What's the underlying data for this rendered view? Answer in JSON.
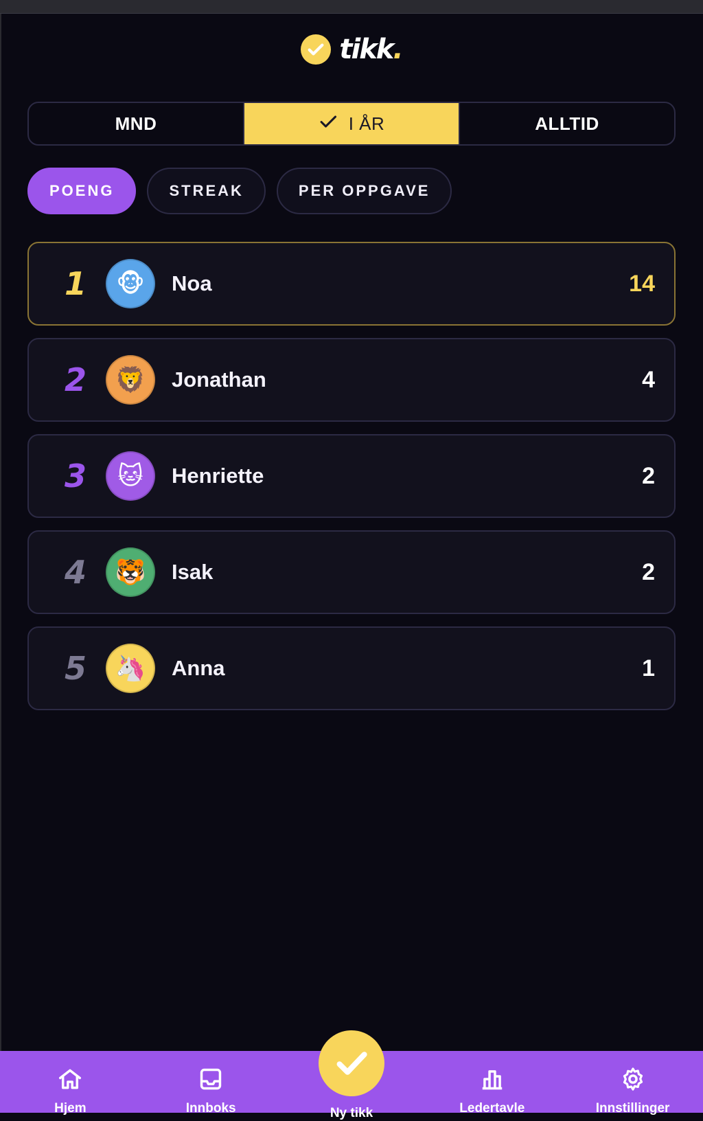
{
  "app": {
    "logo_text": "tikk",
    "logo_dot": ".",
    "accent": "#f8d55b",
    "purple": "#9b55eb"
  },
  "period_tabs": [
    {
      "label": "MND",
      "active": false
    },
    {
      "label": "I ÅR",
      "active": true
    },
    {
      "label": "ALLTID",
      "active": false
    }
  ],
  "category_tabs": [
    {
      "label": "POENG",
      "active": true
    },
    {
      "label": "STREAK",
      "active": false
    },
    {
      "label": "PER OPPGAVE",
      "active": false
    }
  ],
  "leaderboard": [
    {
      "rank": "1",
      "name": "Noa",
      "score": "14",
      "avatar": "🐵",
      "avatar_color": "#5aa5ea",
      "rank_color": "#f8d55b"
    },
    {
      "rank": "2",
      "name": "Jonathan",
      "score": "4",
      "avatar": "🦁",
      "avatar_color": "#f2a04e",
      "rank_color": "#9b55eb"
    },
    {
      "rank": "3",
      "name": "Henriette",
      "score": "2",
      "avatar": "🐱",
      "avatar_color": "#a05be6",
      "rank_color": "#9b55eb"
    },
    {
      "rank": "4",
      "name": "Isak",
      "score": "2",
      "avatar": "🐯",
      "avatar_color": "#4fae72",
      "rank_color": "#7d7a93"
    },
    {
      "rank": "5",
      "name": "Anna",
      "score": "1",
      "avatar": "🦄",
      "avatar_color": "#f8d55b",
      "rank_color": "#7d7a93"
    }
  ],
  "nav": {
    "home": "Hjem",
    "inbox": "Innboks",
    "new": "Ny tikk",
    "leaderboard": "Ledertavle",
    "settings": "Innstillinger"
  }
}
